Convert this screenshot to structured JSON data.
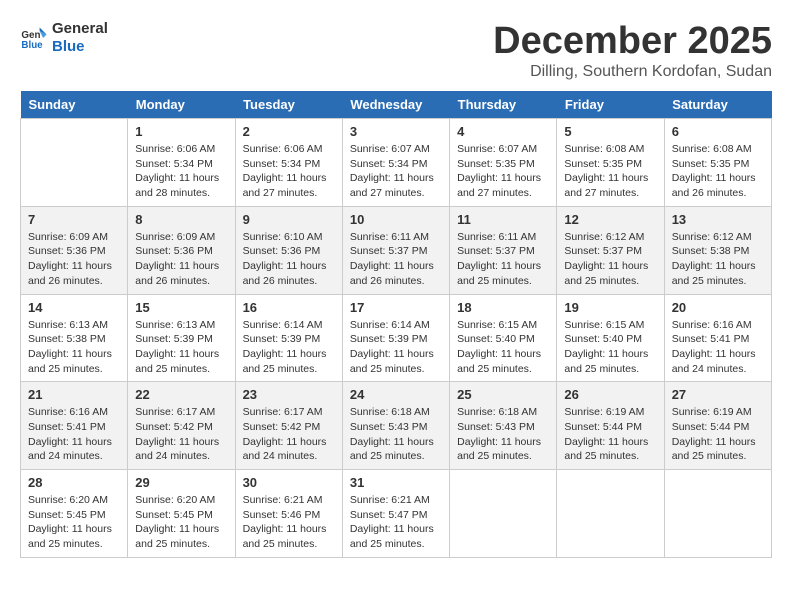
{
  "logo": {
    "line1": "General",
    "line2": "Blue"
  },
  "title": "December 2025",
  "location": "Dilling, Southern Kordofan, Sudan",
  "days_of_week": [
    "Sunday",
    "Monday",
    "Tuesday",
    "Wednesday",
    "Thursday",
    "Friday",
    "Saturday"
  ],
  "weeks": [
    [
      {
        "day": "",
        "empty": true
      },
      {
        "day": "1",
        "sunrise": "6:06 AM",
        "sunset": "5:34 PM",
        "daylight": "11 hours and 28 minutes."
      },
      {
        "day": "2",
        "sunrise": "6:06 AM",
        "sunset": "5:34 PM",
        "daylight": "11 hours and 27 minutes."
      },
      {
        "day": "3",
        "sunrise": "6:07 AM",
        "sunset": "5:34 PM",
        "daylight": "11 hours and 27 minutes."
      },
      {
        "day": "4",
        "sunrise": "6:07 AM",
        "sunset": "5:35 PM",
        "daylight": "11 hours and 27 minutes."
      },
      {
        "day": "5",
        "sunrise": "6:08 AM",
        "sunset": "5:35 PM",
        "daylight": "11 hours and 27 minutes."
      },
      {
        "day": "6",
        "sunrise": "6:08 AM",
        "sunset": "5:35 PM",
        "daylight": "11 hours and 26 minutes."
      }
    ],
    [
      {
        "day": "7",
        "sunrise": "6:09 AM",
        "sunset": "5:36 PM",
        "daylight": "11 hours and 26 minutes."
      },
      {
        "day": "8",
        "sunrise": "6:09 AM",
        "sunset": "5:36 PM",
        "daylight": "11 hours and 26 minutes."
      },
      {
        "day": "9",
        "sunrise": "6:10 AM",
        "sunset": "5:36 PM",
        "daylight": "11 hours and 26 minutes."
      },
      {
        "day": "10",
        "sunrise": "6:11 AM",
        "sunset": "5:37 PM",
        "daylight": "11 hours and 26 minutes."
      },
      {
        "day": "11",
        "sunrise": "6:11 AM",
        "sunset": "5:37 PM",
        "daylight": "11 hours and 25 minutes."
      },
      {
        "day": "12",
        "sunrise": "6:12 AM",
        "sunset": "5:37 PM",
        "daylight": "11 hours and 25 minutes."
      },
      {
        "day": "13",
        "sunrise": "6:12 AM",
        "sunset": "5:38 PM",
        "daylight": "11 hours and 25 minutes."
      }
    ],
    [
      {
        "day": "14",
        "sunrise": "6:13 AM",
        "sunset": "5:38 PM",
        "daylight": "11 hours and 25 minutes."
      },
      {
        "day": "15",
        "sunrise": "6:13 AM",
        "sunset": "5:39 PM",
        "daylight": "11 hours and 25 minutes."
      },
      {
        "day": "16",
        "sunrise": "6:14 AM",
        "sunset": "5:39 PM",
        "daylight": "11 hours and 25 minutes."
      },
      {
        "day": "17",
        "sunrise": "6:14 AM",
        "sunset": "5:39 PM",
        "daylight": "11 hours and 25 minutes."
      },
      {
        "day": "18",
        "sunrise": "6:15 AM",
        "sunset": "5:40 PM",
        "daylight": "11 hours and 25 minutes."
      },
      {
        "day": "19",
        "sunrise": "6:15 AM",
        "sunset": "5:40 PM",
        "daylight": "11 hours and 25 minutes."
      },
      {
        "day": "20",
        "sunrise": "6:16 AM",
        "sunset": "5:41 PM",
        "daylight": "11 hours and 24 minutes."
      }
    ],
    [
      {
        "day": "21",
        "sunrise": "6:16 AM",
        "sunset": "5:41 PM",
        "daylight": "11 hours and 24 minutes."
      },
      {
        "day": "22",
        "sunrise": "6:17 AM",
        "sunset": "5:42 PM",
        "daylight": "11 hours and 24 minutes."
      },
      {
        "day": "23",
        "sunrise": "6:17 AM",
        "sunset": "5:42 PM",
        "daylight": "11 hours and 24 minutes."
      },
      {
        "day": "24",
        "sunrise": "6:18 AM",
        "sunset": "5:43 PM",
        "daylight": "11 hours and 25 minutes."
      },
      {
        "day": "25",
        "sunrise": "6:18 AM",
        "sunset": "5:43 PM",
        "daylight": "11 hours and 25 minutes."
      },
      {
        "day": "26",
        "sunrise": "6:19 AM",
        "sunset": "5:44 PM",
        "daylight": "11 hours and 25 minutes."
      },
      {
        "day": "27",
        "sunrise": "6:19 AM",
        "sunset": "5:44 PM",
        "daylight": "11 hours and 25 minutes."
      }
    ],
    [
      {
        "day": "28",
        "sunrise": "6:20 AM",
        "sunset": "5:45 PM",
        "daylight": "11 hours and 25 minutes."
      },
      {
        "day": "29",
        "sunrise": "6:20 AM",
        "sunset": "5:45 PM",
        "daylight": "11 hours and 25 minutes."
      },
      {
        "day": "30",
        "sunrise": "6:21 AM",
        "sunset": "5:46 PM",
        "daylight": "11 hours and 25 minutes."
      },
      {
        "day": "31",
        "sunrise": "6:21 AM",
        "sunset": "5:47 PM",
        "daylight": "11 hours and 25 minutes."
      },
      {
        "day": "",
        "empty": true
      },
      {
        "day": "",
        "empty": true
      },
      {
        "day": "",
        "empty": true
      }
    ]
  ]
}
